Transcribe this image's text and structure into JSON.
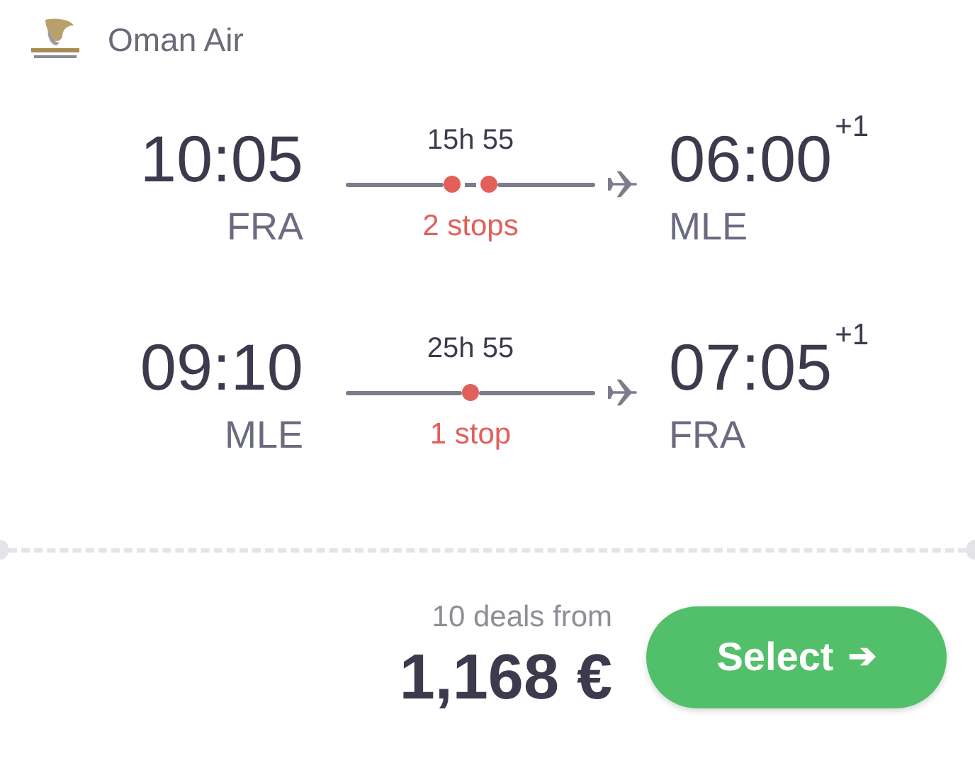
{
  "airline": {
    "name": "Oman Air"
  },
  "legs": [
    {
      "depart_time": "10:05",
      "depart_airport": "FRA",
      "duration": "15h 55",
      "stops_label": "2 stops",
      "stop_markers": [
        {
          "kind": "dot"
        },
        {
          "kind": "dot"
        }
      ],
      "arrive_time": "06:00",
      "day_offset": "+1",
      "arrive_airport": "MLE"
    },
    {
      "depart_time": "09:10",
      "depart_airport": "MLE",
      "duration": "25h 55",
      "stops_label": "1 stop",
      "stop_markers": [
        {
          "kind": "dot"
        }
      ],
      "arrive_time": "07:05",
      "day_offset": "+1",
      "arrive_airport": "FRA"
    }
  ],
  "price": {
    "deals": "10 deals from",
    "amount": "1,168 €"
  },
  "select_button": {
    "label": "Select",
    "icon": "➔"
  }
}
